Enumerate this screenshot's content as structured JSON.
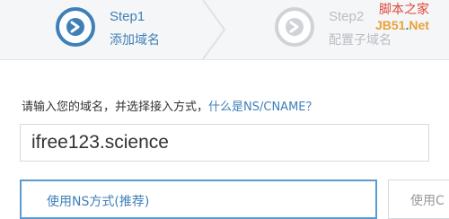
{
  "steps": [
    {
      "title": "Step1",
      "subtitle": "添加域名",
      "state": "active"
    },
    {
      "title": "Step2",
      "subtitle": "配置子域名",
      "state": "inactive"
    }
  ],
  "watermark": {
    "top": "脚本之家",
    "bottom_a": "JB51",
    "bottom_dot": ".",
    "bottom_b": "Net"
  },
  "instruction": {
    "text": "请输入您的域名，并选择接入方式，",
    "link": "什么是NS/CNAME？"
  },
  "domain_input": {
    "value": "ifree123.science"
  },
  "options": {
    "ns_label": "使用NS方式(推荐)",
    "cname_label": "使用C"
  },
  "colors": {
    "accent": "#3f7fb8",
    "inactive": "#b9bec4",
    "selected_border": "#5b9bd5"
  }
}
